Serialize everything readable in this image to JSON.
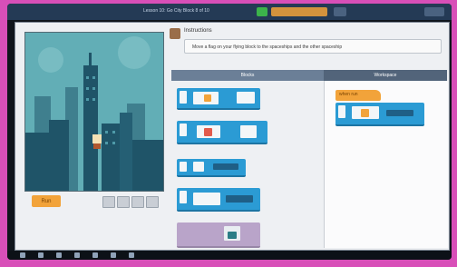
{
  "topbar": {
    "course_title": "Lesson 10: Go City Block 8 of 10",
    "badge_color": "#3cb44b",
    "progress_color": "#f2a33a"
  },
  "instructions": {
    "title": "Instructions",
    "text": "Move a flag on your flying block to the spaceships and the other spaceship"
  },
  "stage": {
    "run_button_label": "Run",
    "sky_color": "#62aeb6",
    "building_color": "#1f5468"
  },
  "workspace": {
    "toolbox_header": "Blocks",
    "workspace_header": "Workspace",
    "when_run_label": "when run"
  },
  "colors": {
    "block_blue": "#2b9bd4",
    "block_orange": "#f2a33a",
    "block_lavender": "#b9a4c9"
  },
  "icons": [
    "run-icon",
    "step-icon",
    "reset-icon",
    "speaker-icon",
    "gear-icon"
  ]
}
